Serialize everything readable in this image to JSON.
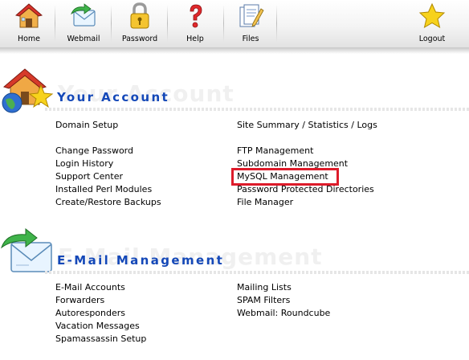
{
  "toolbar": {
    "items": [
      {
        "label": "Home",
        "icon": "home-icon"
      },
      {
        "label": "Webmail",
        "icon": "webmail-icon"
      },
      {
        "label": "Password",
        "icon": "padlock-icon"
      },
      {
        "label": "Help",
        "icon": "question-mark-icon"
      },
      {
        "label": "Files",
        "icon": "files-icon"
      },
      {
        "label": "Logout",
        "icon": "star-icon"
      }
    ]
  },
  "your_account": {
    "title": "Your Account",
    "watermark": "Your Account",
    "icon": "house-globe-star-icon",
    "left_links": [
      "Domain Setup",
      "Change Password",
      "Login History",
      "Support Center",
      "Installed Perl Modules",
      "Create/Restore Backups"
    ],
    "right_links": [
      "Site Summary / Statistics / Logs",
      "FTP Management",
      "Subdomain Management",
      "MySQL Management",
      "Password Protected Directories",
      "File Manager"
    ]
  },
  "email_management": {
    "title": "E-Mail Management",
    "watermark": "E-Mail Management",
    "icon": "envelope-arrow-icon",
    "left_links": [
      "E-Mail Accounts",
      "Forwarders",
      "Autoresponders",
      "Vacation Messages",
      "Spamassassin Setup"
    ],
    "right_links": [
      "Mailing Lists",
      "SPAM Filters",
      "Webmail: Roundcube"
    ]
  },
  "colors": {
    "section_title": "#1448b8",
    "highlight": "#dd1b2a",
    "watermark": "#f0f0f0"
  }
}
